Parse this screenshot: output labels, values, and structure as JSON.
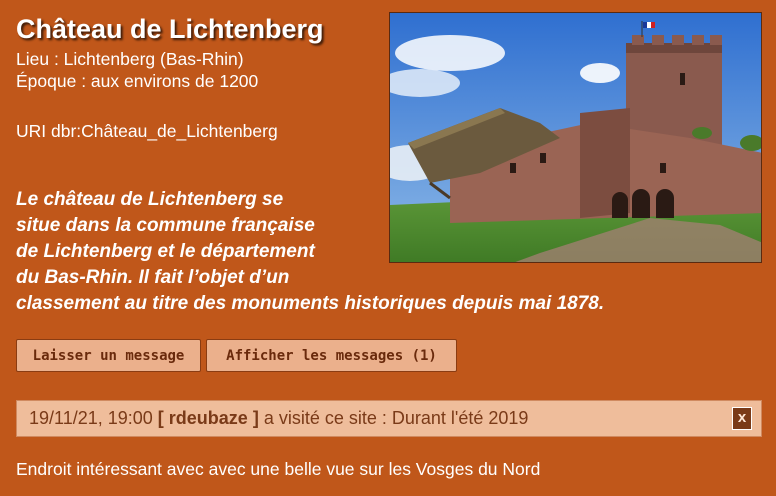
{
  "site": {
    "title": "Château de Lichtenberg",
    "lieu": "Lieu : Lichtenberg (Bas-Rhin)",
    "epoque": "Époque : aux environs de 1200",
    "uri": "URI dbr:Château_de_Lichtenberg",
    "description_lines": [
      "Le château de Lichtenberg se",
      "situe dans la commune française",
      "de Lichtenberg et le département",
      "du Bas-Rhin. Il fait l’objet d’un",
      "classement au titre des monuments historiques depuis mai 1878."
    ]
  },
  "buttons": {
    "leave_message": "Laisser un message",
    "show_messages": "Afficher les messages (1)"
  },
  "visit": {
    "datetime": "19/11/21, 19:00",
    "user": "[ rdeubaze ]",
    "text": "a visité ce site : Durant l'été 2019",
    "close_label": "x",
    "comment": "Endroit intéressant avec avec une belle vue sur les Vosges du Nord"
  },
  "colors": {
    "background": "#c0571a",
    "button_bg": "#ebb08c",
    "bar_bg": "#efbd9b"
  }
}
